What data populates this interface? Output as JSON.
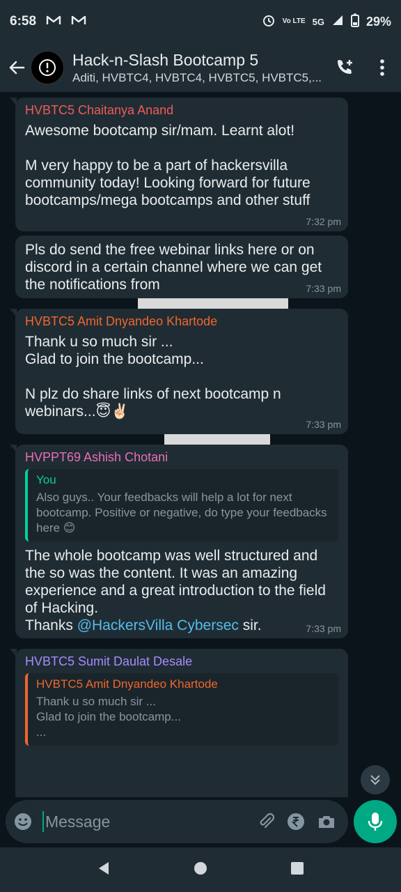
{
  "status_bar": {
    "time": "6:58",
    "network": "5G",
    "lte": "Vo LTE",
    "battery": "29%"
  },
  "header": {
    "title": "Hack-n-Slash Bootcamp 5",
    "subtitle": "Aditi, HVBTC4, HVBTC4, HVBTC5, HVBTC5,..."
  },
  "messages": [
    {
      "sender": "HVBTC5 Chaitanya Anand",
      "sender_color": "#ef5b5b",
      "text": "Awesome bootcamp sir/mam. Learnt alot!\n\nM very happy to be a part of hackersvilla community today! Looking forward for future bootcamps/mega bootcamps and other stuff",
      "time": "7:32 pm"
    },
    {
      "text": "Pls do send the free webinar links here or on discord in a certain channel where we can get the notifications from",
      "time": "7:33 pm"
    },
    {
      "sender": "HVBTC5 Amit Dnyandeo Khartode",
      "sender_color": "#f0662e",
      "text": "Thank u so much sir ...\nGlad to join the bootcamp...\n\nN plz do share links of next bootcamp n webinars...😇✌🏻",
      "time": "7:33 pm"
    },
    {
      "sender": "HVPPT69 Ashish Chotani",
      "sender_color": "#e86fb5",
      "quote_name": "You",
      "quote_color": "#06cf9c",
      "quote_text": "Also guys.. Your feedbacks will help a lot for next bootcamp. Positive or negative, do type your feedbacks here 😊",
      "text_before": "The whole bootcamp was well structured and the so was the content. It was an amazing experience and a great introduction to the field of Hacking.\nThanks ",
      "mention": "@HackersVilla Cybersec",
      "text_after": " sir.",
      "time": "7:33 pm"
    },
    {
      "sender": "HVBTC5 Sumit Daulat Desale",
      "sender_color": "#a48cff",
      "quote_name": "HVBTC5 Amit Dnyandeo Khartode",
      "quote_color": "#f0662e",
      "quote_text": "Thank u so much sir ...\nGlad to join the bootcamp...\n..."
    }
  ],
  "composer": {
    "placeholder": "Message"
  },
  "icons": {
    "back": "arrow-left-icon",
    "add_call": "phone-plus-icon",
    "menu": "more-vert-icon",
    "emoji": "emoji-icon",
    "attach": "paperclip-icon",
    "payment": "rupee-icon",
    "camera": "camera-icon",
    "mic": "mic-icon"
  },
  "colors": {
    "accent": "#00a884",
    "bubble": "#202c33",
    "background": "#0b141a",
    "header": "#1f2c34"
  }
}
